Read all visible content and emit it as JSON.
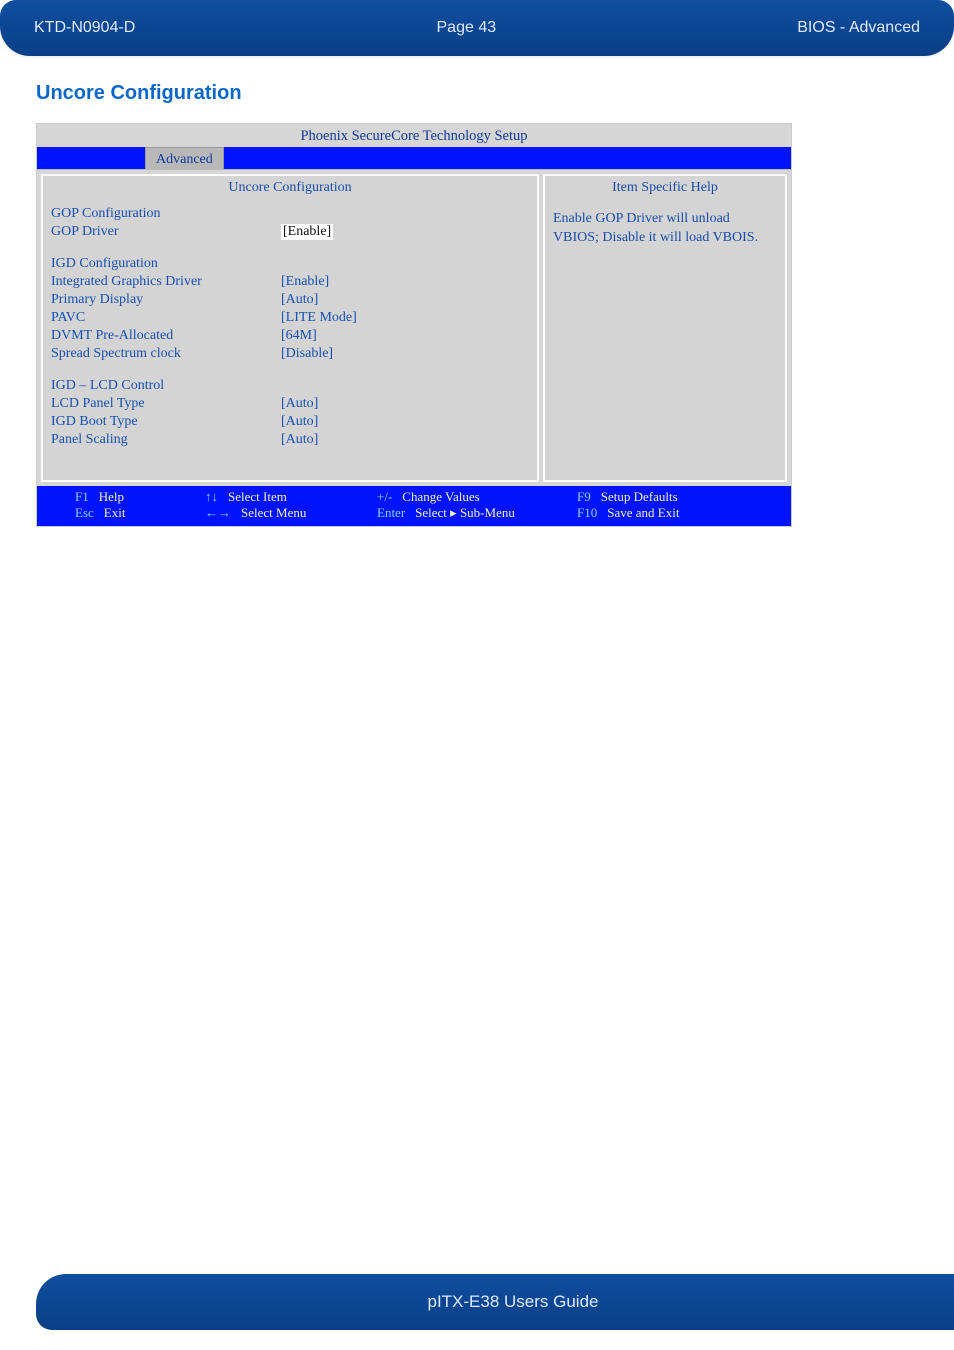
{
  "header": {
    "left": "KTD-N0904-D",
    "center": "Page 43",
    "right": "BIOS  - Advanced"
  },
  "footer": {
    "text": "pITX-E38 Users Guide"
  },
  "section": {
    "title": "Uncore Configuration"
  },
  "bios": {
    "title": "Phoenix SecureCore Technology Setup",
    "tab": "Advanced",
    "left_header": "Uncore Configuration",
    "right_header": "Item Specific Help",
    "help_text": "Enable GOP Driver will unload VBIOS; Disable it will load VBOIS.",
    "groups": {
      "gop": {
        "heading": "GOP Configuration",
        "items": [
          {
            "label": "GOP Driver",
            "value": "[Enable]",
            "selected": true
          }
        ]
      },
      "igd": {
        "heading": "IGD Configuration",
        "items": [
          {
            "label": "Integrated Graphics Driver",
            "value": "[Enable]"
          },
          {
            "label": "Primary Display",
            "value": "[Auto]"
          },
          {
            "label": "PAVC",
            "value": "[LITE Mode]"
          },
          {
            "label": "DVMT Pre-Allocated",
            "value": "[64M]"
          },
          {
            "label": "Spread Spectrum clock",
            "value": "[Disable]"
          }
        ]
      },
      "lcd": {
        "heading": "IGD – LCD Control",
        "items": [
          {
            "label": "LCD Panel Type",
            "value": "[Auto]"
          },
          {
            "label": "IGD Boot Type",
            "value": "[Auto]"
          },
          {
            "label": "Panel Scaling",
            "value": "[Auto]"
          }
        ]
      }
    },
    "keys": {
      "line1": [
        {
          "key": "F1",
          "action": "Help"
        },
        {
          "key": "↑↓",
          "action": "Select Item"
        },
        {
          "key": "+/-",
          "action": "Change Values"
        },
        {
          "key": "F9",
          "action": "Setup Defaults"
        }
      ],
      "line2": [
        {
          "key": "Esc",
          "action": "Exit"
        },
        {
          "key": "←→",
          "action": "Select Menu"
        },
        {
          "key": "Enter",
          "action": "Select ▸ Sub-Menu"
        },
        {
          "key": "F10",
          "action": "Save and Exit"
        }
      ]
    }
  }
}
